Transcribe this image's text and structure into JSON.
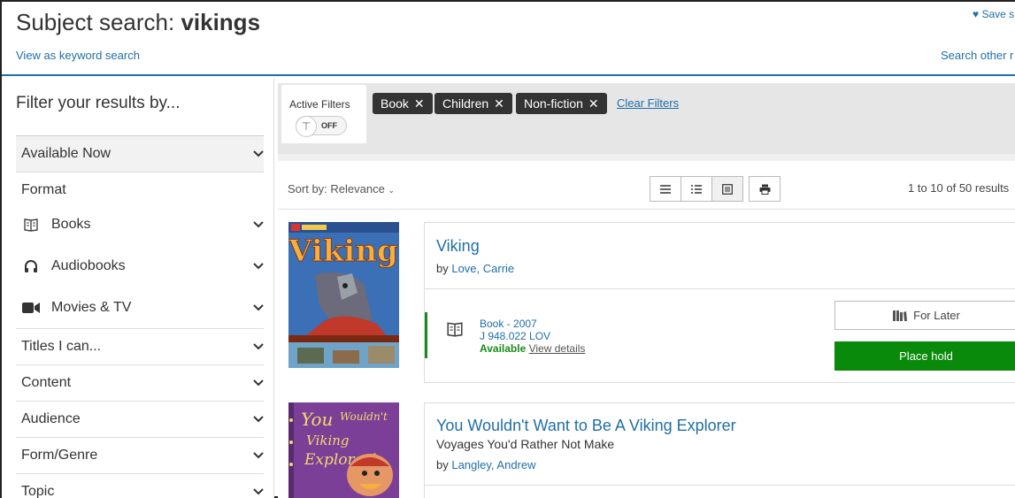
{
  "header": {
    "title_prefix": "Subject search: ",
    "title_term": "vikings",
    "keyword_link": "View as keyword search",
    "save_link": "Save s",
    "other_link": "Search other r"
  },
  "sidebar": {
    "title": "Filter your results by...",
    "available_now": "Available Now",
    "format_label": "Format",
    "format_items": [
      {
        "label": "Books",
        "icon": "book-icon"
      },
      {
        "label": "Audiobooks",
        "icon": "headphones-icon"
      },
      {
        "label": "Movies & TV",
        "icon": "video-camera-icon"
      }
    ],
    "sections": [
      "Titles I can...",
      "Content",
      "Audience",
      "Form/Genre",
      "Topic"
    ]
  },
  "filters": {
    "active_label": "Active Filters",
    "toggle_state": "OFF",
    "chips": [
      "Book",
      "Children",
      "Non-fiction"
    ],
    "clear_label": "Clear Filters"
  },
  "toolbar": {
    "sort_label": "Sort by: Relevance",
    "results_count": "1 to 10 of 50 results"
  },
  "results": [
    {
      "title": "Viking",
      "subtitle": "",
      "author_prefix": "by ",
      "author": "Love, Carrie",
      "format": "Book - 2007",
      "call_number": "J 948.022 LOV",
      "availability": "Available",
      "details_link": "View details",
      "for_later": "For Later",
      "place_hold": "Place hold"
    },
    {
      "title": "You Wouldn't Want to Be A Viking Explorer",
      "subtitle": "Voyages You'd Rather Not Make",
      "author_prefix": "by ",
      "author": "Langley, Andrew"
    }
  ],
  "colors": {
    "link": "#1f6fa8",
    "available": "#1a8a1a",
    "place_hold": "#0a8a0a",
    "chip": "#333333"
  }
}
